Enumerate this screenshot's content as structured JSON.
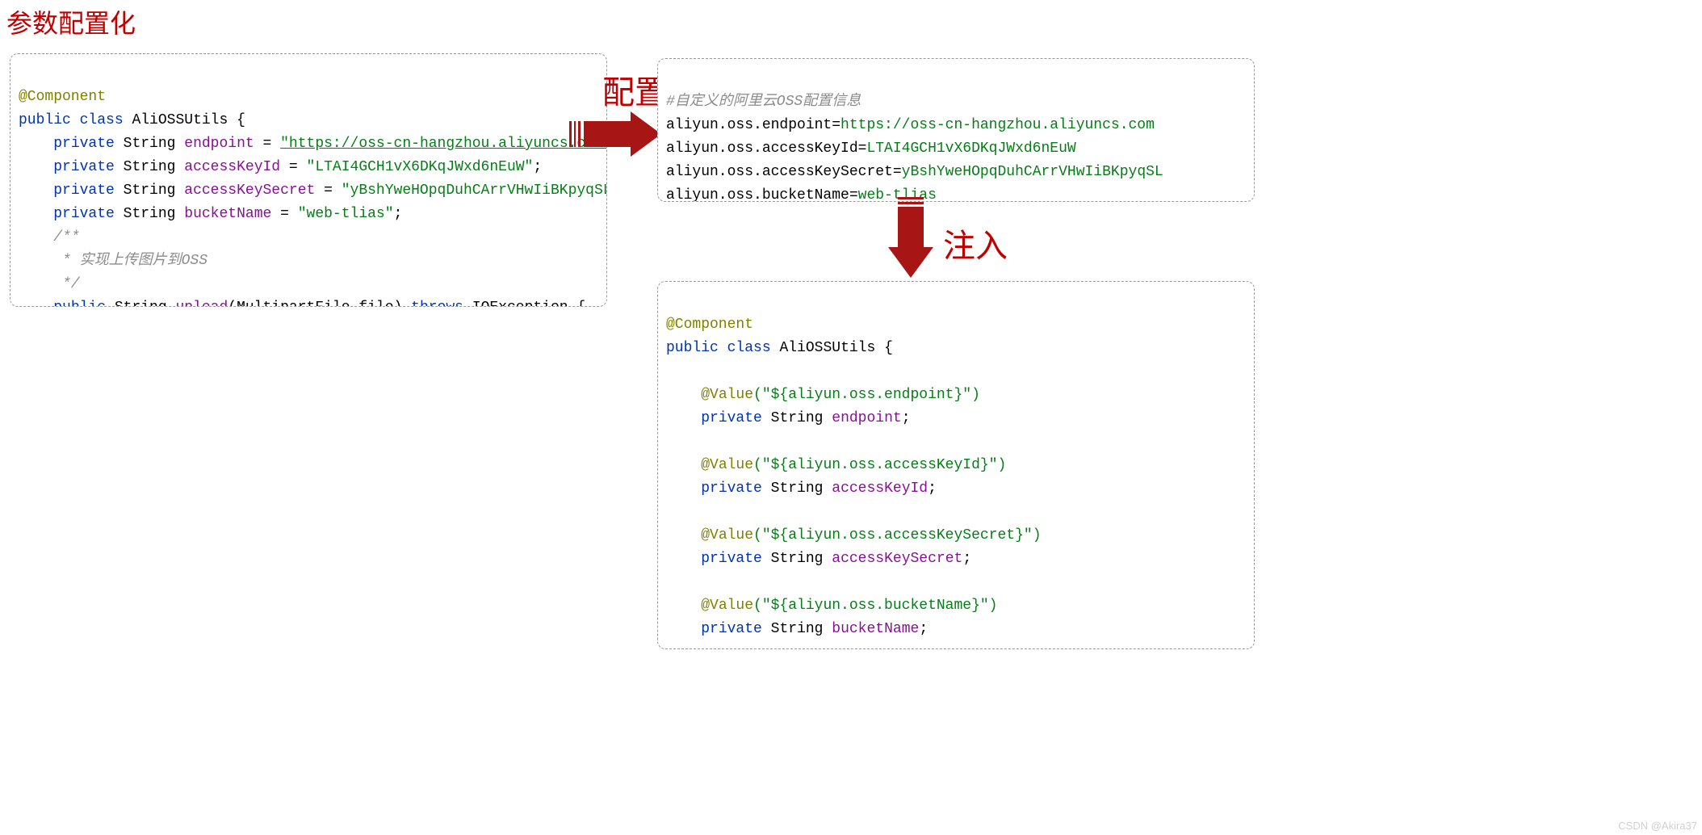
{
  "title": "参数配置化",
  "arrow_config_label": "配置",
  "arrow_inject_label": "注入",
  "watermark": "CSDN @Akira37",
  "left": {
    "ann_component": "@Component",
    "kw_public": "public",
    "kw_class": "class",
    "cls_name": "AliOSSUtils",
    "brace_open": " {",
    "kw_private": "private",
    "type_string": "String",
    "fld_endpoint": "endpoint",
    "eq": " = ",
    "val_endpoint": "\"https://oss-cn-hangzhou.aliyuncs.com\"",
    "fld_accessKeyId": "accessKeyId",
    "val_accessKeyId": "\"LTAI4GCH1vX6DKqJWxd6nEuW\"",
    "fld_accessKeySecret": "accessKeySecret",
    "val_accessKeySecret": "\"yBshYweHOpqDuhCArrVHwIiBKpyqSL\"",
    "fld_bucketName": "bucketName",
    "val_bucketName": "\"web-tlias\"",
    "cmt_open": "/**",
    "cmt_body": " * 实现上传图片到OSS",
    "cmt_close": " */",
    "mtd_upload": "upload",
    "sig_params": "(MultipartFile file)",
    "kw_throws": "throws",
    "exc": "IOException",
    "semi": ";"
  },
  "config": {
    "cmt_line": "#自定义的阿里云OSS配置信息",
    "k_endpoint": "aliyun.oss.endpoint",
    "v_endpoint": "https://oss-cn-hangzhou.aliyuncs.com",
    "k_accessKeyId": "aliyun.oss.accessKeyId",
    "v_accessKeyId": "LTAI4GCH1vX6DKqJWxd6nEuW",
    "k_accessKeySecret": "aliyun.oss.accessKeySecret",
    "v_accessKeySecret": "yBshYweHOpqDuhCArrVHwIiBKpyqSL",
    "k_bucketName": "aliyun.oss.bucketName",
    "v_bucketName": "web-tlias",
    "eq": "="
  },
  "right": {
    "ann_component": "@Component",
    "kw_public": "public",
    "kw_class": "class",
    "cls_name": "AliOSSUtils",
    "brace_open": " {",
    "ann_value": "@Value",
    "val_endpoint_expr": "(\"${aliyun.oss.endpoint}\")",
    "kw_private": "private",
    "type_string": "String",
    "fld_endpoint": "endpoint",
    "val_accessKeyId_expr": "(\"${aliyun.oss.accessKeyId}\")",
    "fld_accessKeyId": "accessKeyId",
    "val_accessKeySecret_expr": "(\"${aliyun.oss.accessKeySecret}\")",
    "fld_accessKeySecret": "accessKeySecret",
    "val_bucketName_expr": "(\"${aliyun.oss.bucketName}\")",
    "fld_bucketName": "bucketName",
    "semi": ";"
  }
}
